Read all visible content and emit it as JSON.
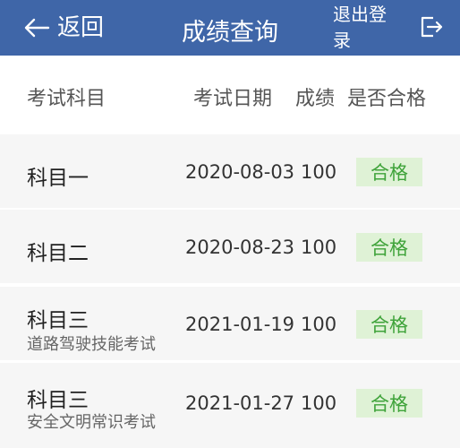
{
  "header": {
    "back_label": "返回",
    "title": "成绩查询",
    "logout_label": "退出登录"
  },
  "table": {
    "columns": [
      "考试科目",
      "考试日期",
      "成绩",
      "是否合格"
    ],
    "rows": [
      {
        "subject": "科目一",
        "note": "",
        "date": "2020-08-03",
        "score": "100",
        "result": "合格"
      },
      {
        "subject": "科目二",
        "note": "",
        "date": "2020-08-23",
        "score": "100",
        "result": "合格"
      },
      {
        "subject": "科目三",
        "note": "道路驾驶技能考试",
        "date": "2021-01-19",
        "score": "100",
        "result": "合格"
      },
      {
        "subject": "科目三",
        "note": "安全文明常识考试",
        "date": "2021-01-27",
        "score": "100",
        "result": "合格"
      }
    ]
  },
  "colors": {
    "header_bg": "#3f66a8",
    "pass_bg": "#dff2d6",
    "pass_text": "#3fa33a",
    "row_bg": "#f6f6f6"
  },
  "icons": {
    "back": "left-arrow-icon",
    "logout": "logout-icon"
  }
}
